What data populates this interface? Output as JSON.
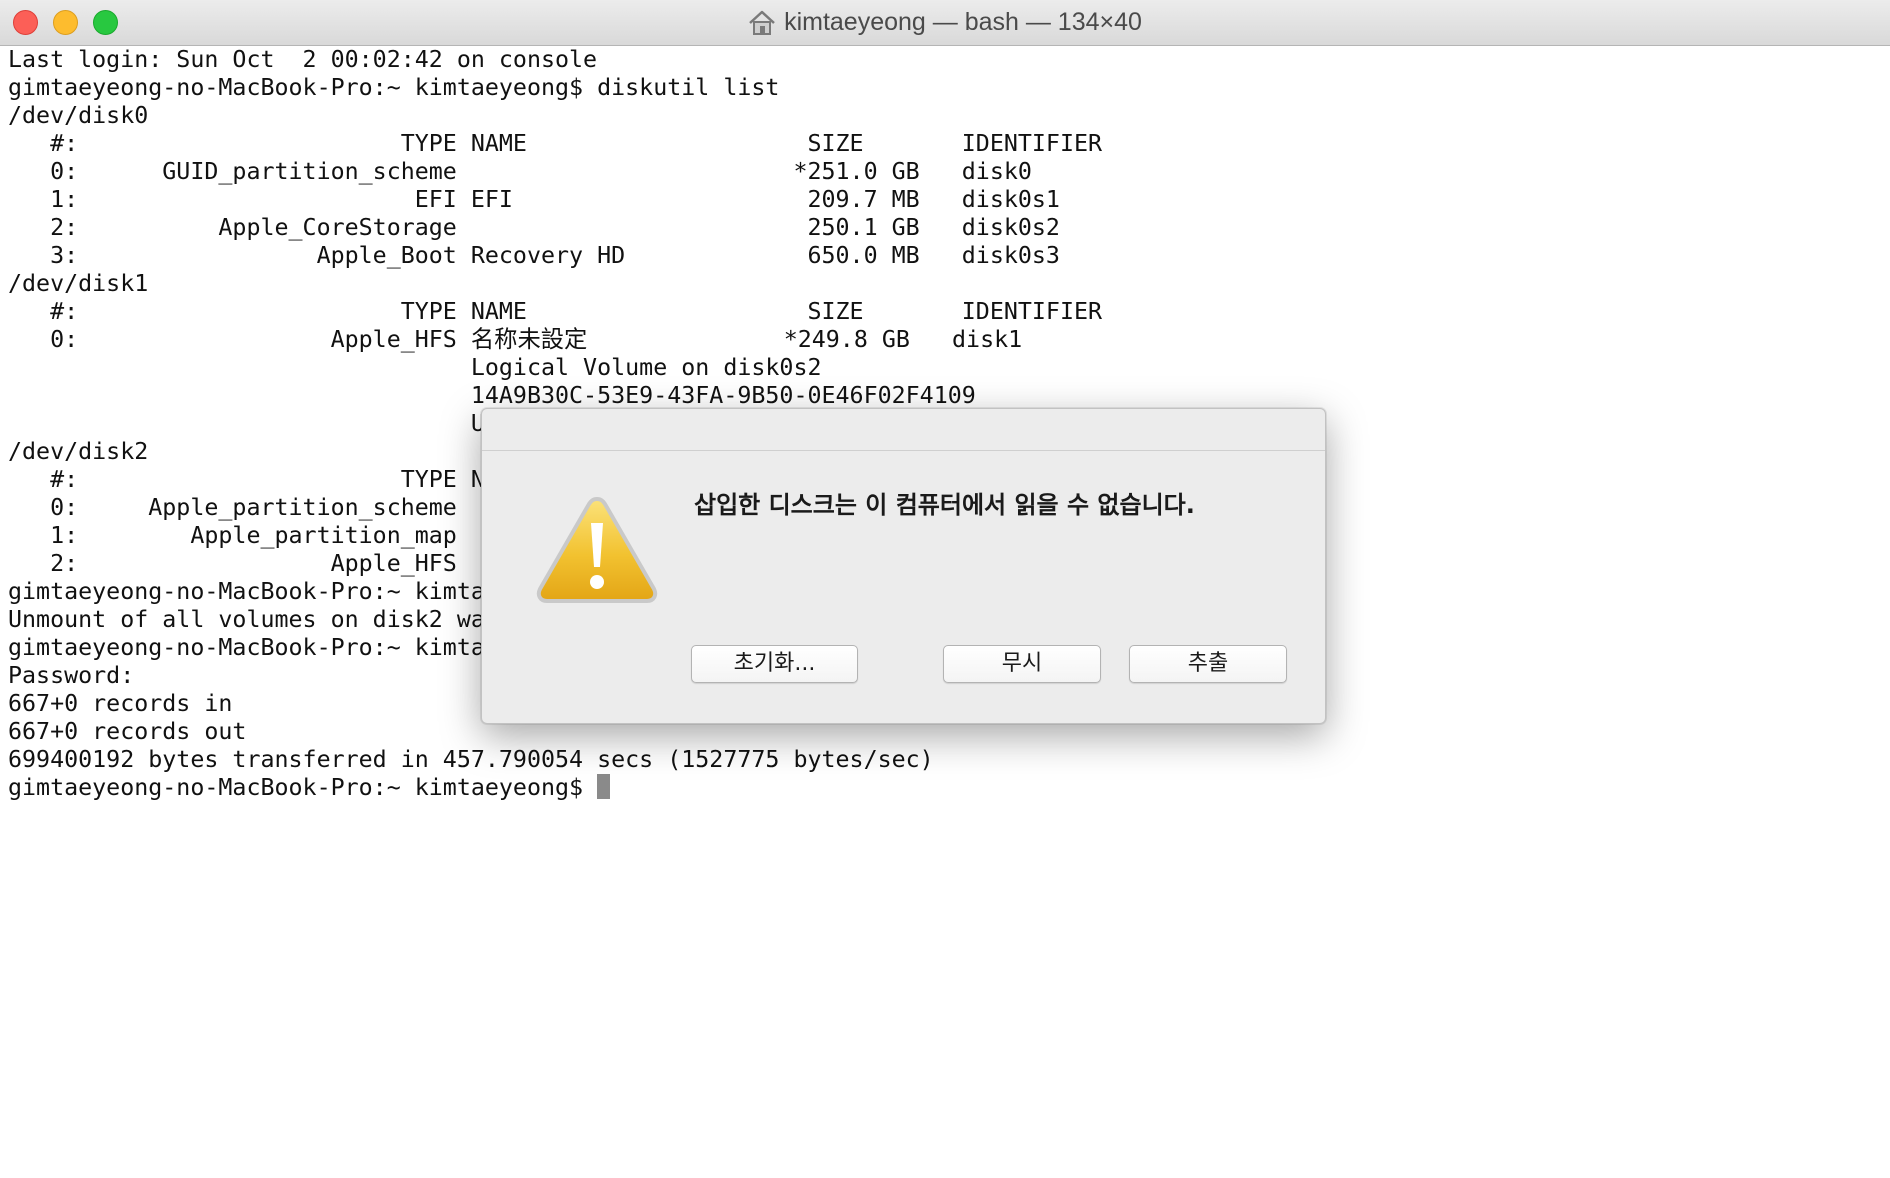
{
  "window": {
    "title": "kimtaeyeong — bash — 134×40",
    "title_icon": "home-icon",
    "controls": {
      "close": "close-button",
      "minimize": "minimize-button",
      "zoom": "zoom-button"
    }
  },
  "terminal": {
    "lines": [
      "Last login: Sun Oct  2 00:02:42 on console",
      "gimtaeyeong-no-MacBook-Pro:~ kimtaeyeong$ diskutil list",
      "/dev/disk0",
      "   #:                       TYPE NAME                    SIZE       IDENTIFIER",
      "   0:      GUID_partition_scheme                        *251.0 GB   disk0",
      "   1:                        EFI EFI                     209.7 MB   disk0s1",
      "   2:          Apple_CoreStorage                         250.1 GB   disk0s2",
      "   3:                 Apple_Boot Recovery HD             650.0 MB   disk0s3",
      "/dev/disk1",
      "   #:                       TYPE NAME                    SIZE       IDENTIFIER",
      "   0:                  Apple_HFS 名称未設定              *249.8 GB   disk1",
      "                                 Logical Volume on disk0s2",
      "                                 14A9B30C-53E9-43FA-9B50-0E46F02F4109",
      "                                 U",
      "/dev/disk2",
      "   #:                       TYPE N",
      "   0:     Apple_partition_scheme",
      "   1:        Apple_partition_map",
      "   2:                  Apple_HFS",
      "gimtaeyeong-no-MacBook-Pro:~ kimta",
      "Unmount of all volumes on disk2 wa",
      "gimtaeyeong-no-MacBook-Pro:~ kimta",
      "Password:",
      "667+0 records in",
      "667+0 records out",
      "699400192 bytes transferred in 457.790054 secs (1527775 bytes/sec)"
    ],
    "prompt": "gimtaeyeong-no-MacBook-Pro:~ kimtaeyeong$ "
  },
  "dialog": {
    "icon": "warning-icon",
    "message": "삽입한 디스크는 이 컴퓨터에서 읽을 수 없습니다.",
    "buttons": {
      "initialize": "초기화...",
      "ignore": "무시",
      "eject": "추출"
    }
  },
  "colors": {
    "close": "#fc5f57",
    "minimize": "#fdbc2e",
    "zoom": "#28c840",
    "warning_fill": "#f2c230",
    "cursor": "#8a8a8a"
  }
}
